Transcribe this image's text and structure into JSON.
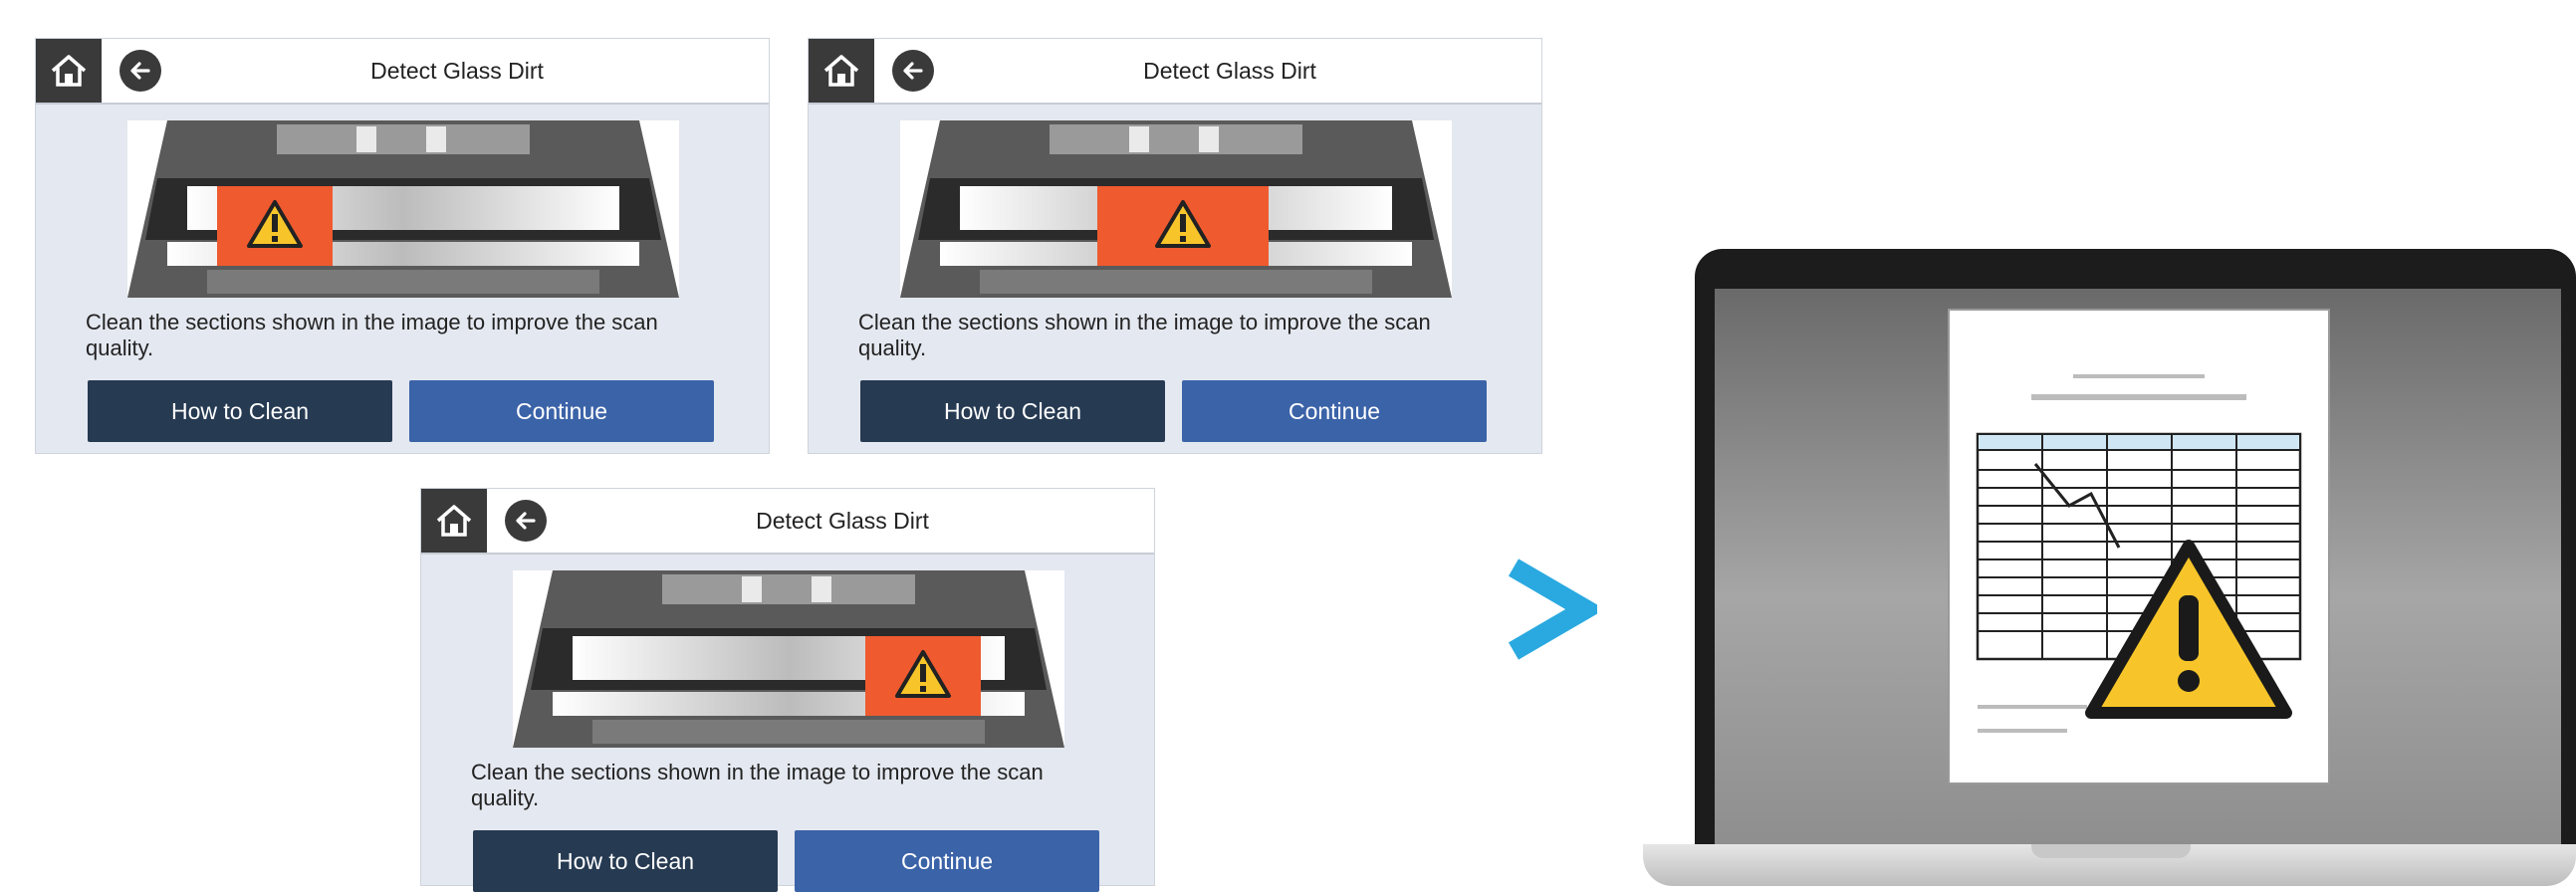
{
  "screens": [
    {
      "title": "Detect Glass Dirt",
      "description": "Clean the sections shown in the image to improve the scan quality.",
      "how_to_clean_label": "How to Clean",
      "continue_label": "Continue",
      "highlight": "left"
    },
    {
      "title": "Detect Glass Dirt",
      "description": "Clean the sections shown in the image to improve the scan quality.",
      "how_to_clean_label": "How to Clean",
      "continue_label": "Continue",
      "highlight": "center"
    },
    {
      "title": "Detect Glass Dirt",
      "description": "Clean the sections shown in the image to improve the scan quality.",
      "how_to_clean_label": "How to Clean",
      "continue_label": "Continue",
      "highlight": "right"
    }
  ],
  "colors": {
    "header_button": "#3a3a3a",
    "how_to_clean_button": "#263a52",
    "continue_button": "#3b63a8",
    "dirt_highlight": "#ef5a2f",
    "warning_yellow": "#f7c52a",
    "arrow": "#29a9e0"
  },
  "icons": {
    "home": "home-icon",
    "back": "back-arrow-icon",
    "warning": "warning-icon",
    "next": "chevron-right-icon"
  }
}
